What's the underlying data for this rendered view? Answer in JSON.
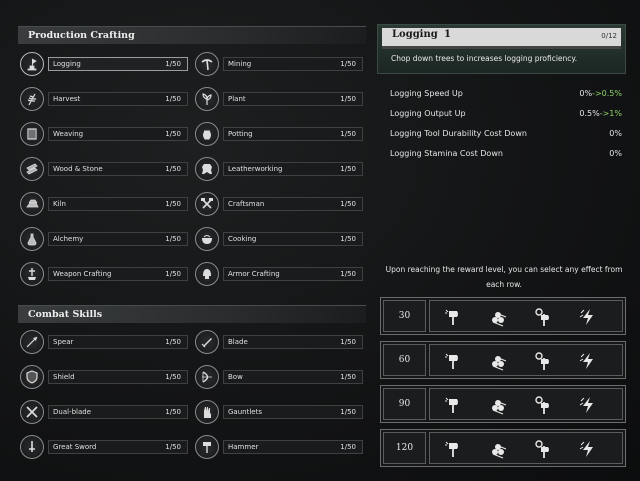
{
  "sections": {
    "production": "Production Crafting",
    "combat": "Combat Skills"
  },
  "production_skills": [
    {
      "name": "Logging",
      "level": "1/50",
      "icon": "axe-stump-icon"
    },
    {
      "name": "Mining",
      "level": "1/50",
      "icon": "pickaxe-icon"
    },
    {
      "name": "Harvest",
      "level": "1/50",
      "icon": "wheat-icon"
    },
    {
      "name": "Plant",
      "level": "1/50",
      "icon": "sprout-icon"
    },
    {
      "name": "Weaving",
      "level": "1/50",
      "icon": "loom-icon"
    },
    {
      "name": "Potting",
      "level": "1/50",
      "icon": "pot-icon"
    },
    {
      "name": "Wood & Stone",
      "level": "1/50",
      "icon": "planks-icon"
    },
    {
      "name": "Leatherworking",
      "level": "1/50",
      "icon": "hide-icon"
    },
    {
      "name": "Kiln",
      "level": "1/50",
      "icon": "ingot-icon"
    },
    {
      "name": "Craftsman",
      "level": "1/50",
      "icon": "hammer-cross-icon"
    },
    {
      "name": "Alchemy",
      "level": "1/50",
      "icon": "flask-icon"
    },
    {
      "name": "Cooking",
      "level": "1/50",
      "icon": "bowl-icon"
    },
    {
      "name": "Weapon Crafting",
      "level": "1/50",
      "icon": "anvil-icon"
    },
    {
      "name": "Armor Crafting",
      "level": "1/50",
      "icon": "helmet-icon"
    }
  ],
  "combat_skills": [
    {
      "name": "Spear",
      "level": "1/50",
      "icon": "spear-icon"
    },
    {
      "name": "Blade",
      "level": "1/50",
      "icon": "blade-icon"
    },
    {
      "name": "Shield",
      "level": "1/50",
      "icon": "shield-icon"
    },
    {
      "name": "Bow",
      "level": "1/50",
      "icon": "bow-icon"
    },
    {
      "name": "Dual-blade",
      "level": "1/50",
      "icon": "crossed-swords-icon"
    },
    {
      "name": "Gauntlets",
      "level": "1/50",
      "icon": "gauntlet-icon"
    },
    {
      "name": "Great Sword",
      "level": "1/50",
      "icon": "greatsword-icon"
    },
    {
      "name": "Hammer",
      "level": "1/50",
      "icon": "warhammer-icon"
    }
  ],
  "detail": {
    "name": "Logging",
    "level": "1",
    "xp": "0/12",
    "xp_fraction": 0,
    "description": "Chop down trees to increases logging proficiency."
  },
  "stats": [
    {
      "label": "Logging Speed Up",
      "current": "0%",
      "arrow": "->",
      "next": "0.5%"
    },
    {
      "label": "Logging Output Up",
      "current": "0.5%",
      "arrow": "->",
      "next": "1%"
    },
    {
      "label": "Logging Tool Durability Cost Down",
      "current": "0%",
      "arrow": "",
      "next": ""
    },
    {
      "label": "Logging Stamina Cost Down",
      "current": "0%",
      "arrow": "",
      "next": ""
    }
  ],
  "reward_note": "Upon reaching the reward level, you can select any effect from each row.",
  "reward_rows": [
    {
      "level": "30",
      "options": [
        "axe-speed-icon",
        "logs-icon",
        "axe-gear-icon",
        "lightning-icon"
      ]
    },
    {
      "level": "60",
      "options": [
        "axe-speed-icon",
        "logs-icon",
        "axe-gear-icon",
        "lightning-icon"
      ]
    },
    {
      "level": "90",
      "options": [
        "axe-speed-icon",
        "logs-icon",
        "axe-gear-icon",
        "lightning-icon"
      ]
    },
    {
      "level": "120",
      "options": [
        "axe-speed-icon",
        "logs-icon",
        "axe-gear-icon",
        "lightning-icon"
      ]
    }
  ],
  "colors": {
    "bonus_green": "#8fd36a",
    "panel_green": "#2a3a33"
  }
}
